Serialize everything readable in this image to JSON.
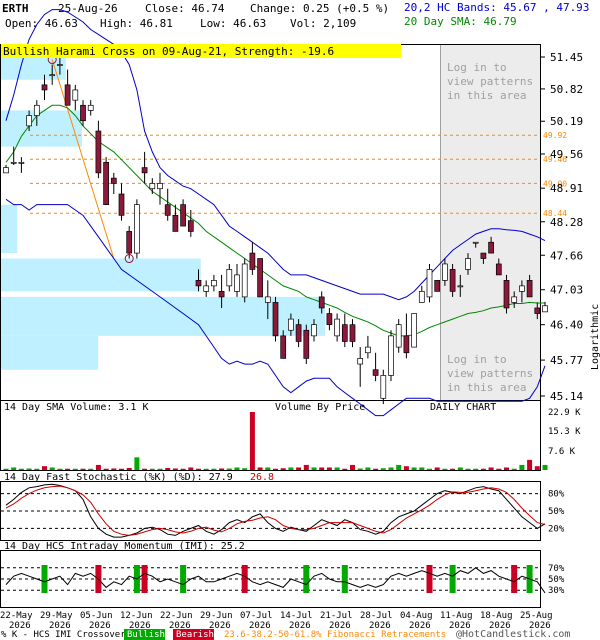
{
  "header": {
    "symbol": "ERTH",
    "date": "25-Aug-26",
    "close_label": "Close: 46.74",
    "change_label": "Change: 0.25 (+0.5 %)",
    "open_label": "Open: 46.63",
    "high_label": "High: 46.81",
    "low_label": "Low: 46.63",
    "vol_label": "Vol: 2,109",
    "bands_label": "20,2 HC Bands: 45.67 , 47.93",
    "sma_label": "20 Day SMA: 46.79"
  },
  "pattern_banner": "Bullish Harami Cross on 09-Aug-21, Strength: -19.6",
  "login_note": [
    "Log in to",
    "view patterns",
    "in this area"
  ],
  "panel_labels": {
    "volume": "14 Day SMA Volume: 3.1 K",
    "volume_by_price": "Volume By Price",
    "daily_chart": "DAILY CHART",
    "stochastic": "14 Day Fast Stochastic (%K) (%D): 27.9",
    "stochastic_d": "26.8",
    "momentum": "14 Day HCS Intraday Momentum (IMI): 25.2",
    "log_axis": "Logarithmic"
  },
  "footer": {
    "legend_prefix": "% K - HCS IMI Crossover:",
    "bullish": "Bullish",
    "bearish": "Bearish",
    "fib": "23.6-38.2-50-61.8% Fibonacci Retracements",
    "copyright": "@HotCandlestick.com"
  },
  "colors": {
    "bullish": "#00aa00",
    "bearish": "#cc0022",
    "candle_up": "#ffffff",
    "candle_down": "#8b1a3a",
    "band": "#0000cc",
    "sma": "#008800",
    "fib": "#ff8800",
    "vbp": "#bff0ff",
    "banner": "#ffff00"
  },
  "chart_data": {
    "type": "candlestick",
    "y_ticks": [
      "51.45",
      "50.82",
      "50.19",
      "49.56",
      "48.91",
      "48.28",
      "47.66",
      "47.03",
      "46.40",
      "45.77",
      "45.14"
    ],
    "fib_levels": [
      "49.92",
      "49.46",
      "49.00",
      "48.44"
    ],
    "x_labels": [
      [
        "22-May",
        "2026"
      ],
      [
        "29-May",
        "2026"
      ],
      [
        "05-Jun",
        "2026"
      ],
      [
        "12-Jun",
        "2026"
      ],
      [
        "22-Jun",
        "2026"
      ],
      [
        "29-Jun",
        "2026"
      ],
      [
        "07-Jul",
        "2026"
      ],
      [
        "14-Jul",
        "2026"
      ],
      [
        "21-Jul",
        "2026"
      ],
      [
        "28-Jul",
        "2026"
      ],
      [
        "04-Aug",
        "2026"
      ],
      [
        "11-Aug",
        "2026"
      ],
      [
        "18-Aug",
        "2026"
      ],
      [
        "25-Aug",
        "2026"
      ]
    ],
    "candles": [
      [
        49.2,
        49.35,
        49.2,
        49.3
      ],
      [
        49.4,
        49.7,
        49.35,
        49.4
      ],
      [
        49.4,
        49.5,
        49.2,
        49.4
      ],
      [
        50.1,
        50.4,
        50.0,
        50.3
      ],
      [
        50.3,
        50.6,
        50.1,
        50.5
      ],
      [
        50.9,
        51.1,
        50.6,
        50.8
      ],
      [
        51.1,
        51.3,
        50.9,
        51.1
      ],
      [
        51.3,
        51.45,
        51.1,
        51.3
      ],
      [
        50.9,
        51.2,
        50.5,
        50.5
      ],
      [
        50.6,
        50.9,
        50.4,
        50.8
      ],
      [
        50.5,
        50.6,
        50.1,
        50.2
      ],
      [
        50.4,
        50.6,
        50.3,
        50.5
      ],
      [
        50.0,
        50.2,
        49.1,
        49.2
      ],
      [
        49.4,
        49.5,
        48.6,
        48.6
      ],
      [
        49.1,
        49.2,
        48.8,
        49.0
      ],
      [
        48.8,
        49.0,
        48.3,
        48.4
      ],
      [
        48.1,
        48.2,
        47.6,
        47.7
      ],
      [
        47.7,
        48.7,
        47.6,
        48.6
      ],
      [
        49.3,
        49.6,
        49.0,
        49.2
      ],
      [
        48.9,
        49.1,
        48.8,
        49.0
      ],
      [
        48.9,
        49.2,
        48.6,
        49.0
      ],
      [
        48.6,
        48.9,
        48.3,
        48.4
      ],
      [
        48.4,
        48.6,
        48.1,
        48.1
      ],
      [
        48.6,
        48.7,
        48.2,
        48.2
      ],
      [
        48.3,
        48.5,
        48.0,
        48.1
      ],
      [
        47.2,
        47.4,
        47.0,
        47.1
      ],
      [
        47.0,
        47.2,
        46.9,
        47.1
      ],
      [
        47.1,
        47.3,
        47.0,
        47.2
      ],
      [
        47.0,
        47.3,
        46.7,
        46.9
      ],
      [
        47.1,
        47.5,
        47.0,
        47.4
      ],
      [
        47.0,
        47.5,
        46.9,
        47.3
      ],
      [
        46.9,
        47.6,
        46.8,
        47.5
      ],
      [
        47.7,
        47.9,
        47.3,
        47.4
      ],
      [
        47.6,
        47.6,
        46.9,
        46.9
      ],
      [
        46.8,
        47.2,
        46.5,
        46.9
      ],
      [
        46.8,
        46.9,
        46.1,
        46.2
      ],
      [
        46.2,
        46.3,
        45.8,
        45.8
      ],
      [
        46.3,
        46.6,
        46.2,
        46.5
      ],
      [
        46.4,
        46.5,
        46.0,
        46.1
      ],
      [
        46.3,
        46.4,
        45.7,
        45.8
      ],
      [
        46.2,
        46.5,
        46.1,
        46.4
      ],
      [
        46.9,
        47.0,
        46.6,
        46.7
      ],
      [
        46.6,
        46.7,
        46.3,
        46.4
      ],
      [
        46.2,
        46.6,
        46.1,
        46.5
      ],
      [
        46.4,
        46.6,
        46.0,
        46.1
      ],
      [
        46.4,
        46.5,
        46.0,
        46.1
      ],
      [
        45.7,
        46.0,
        45.3,
        45.8
      ],
      [
        45.9,
        46.2,
        45.8,
        46.0
      ],
      [
        45.6,
        45.9,
        45.4,
        45.5
      ],
      [
        45.1,
        45.6,
        45.0,
        45.5
      ],
      [
        45.5,
        46.3,
        45.4,
        46.2
      ],
      [
        46.0,
        46.5,
        45.9,
        46.4
      ],
      [
        46.2,
        46.6,
        45.8,
        45.9
      ],
      [
        46.0,
        46.6,
        46.0,
        46.6
      ],
      [
        46.8,
        47.1,
        46.8,
        47.0
      ],
      [
        46.9,
        47.5,
        46.8,
        47.4
      ],
      [
        47.2,
        47.2,
        47.0,
        47.0
      ],
      [
        47.2,
        47.6,
        47.1,
        47.5
      ],
      [
        47.4,
        47.5,
        46.9,
        47.0
      ],
      [
        47.1,
        47.3,
        46.9,
        47.1
      ],
      [
        47.4,
        47.7,
        47.3,
        47.6
      ],
      [
        47.9,
        47.9,
        47.8,
        47.9
      ],
      [
        47.7,
        47.7,
        47.5,
        47.6
      ],
      [
        47.9,
        48.0,
        47.7,
        47.7
      ],
      [
        47.5,
        47.6,
        47.3,
        47.3
      ],
      [
        47.2,
        47.3,
        46.6,
        46.7
      ],
      [
        46.8,
        47.0,
        46.7,
        46.9
      ],
      [
        47.0,
        47.2,
        46.8,
        47.1
      ],
      [
        47.2,
        47.3,
        46.9,
        46.9
      ],
      [
        46.7,
        46.8,
        46.5,
        46.6
      ],
      [
        46.63,
        46.81,
        46.63,
        46.74
      ]
    ],
    "sma": [
      49.4,
      49.6,
      49.9,
      50.1,
      50.3,
      50.4,
      50.5,
      50.5,
      50.45,
      50.3,
      50.1,
      49.95,
      49.8,
      49.7,
      49.6,
      49.45,
      49.3,
      49.15,
      49.0,
      48.85,
      48.75,
      48.65,
      48.55,
      48.45,
      48.35,
      48.25,
      48.1,
      48.0,
      47.9,
      47.8,
      47.7,
      47.6,
      47.5,
      47.4,
      47.3,
      47.2,
      47.1,
      47.05,
      47.0,
      46.9,
      46.85,
      46.8,
      46.75,
      46.7,
      46.62,
      46.55,
      46.5,
      46.45,
      46.38,
      46.3,
      46.25,
      46.2,
      46.2,
      46.22,
      46.28,
      46.35,
      46.4,
      46.45,
      46.5,
      46.55,
      46.6,
      46.62,
      46.65,
      46.7,
      46.72,
      46.75,
      46.78,
      46.78,
      46.8,
      46.79,
      46.79
    ],
    "band_upper": [
      50.2,
      50.7,
      51.3,
      51.8,
      52.1,
      52.3,
      52.4,
      52.4,
      52.35,
      52.25,
      52.15,
      52.0,
      51.9,
      51.8,
      51.7,
      51.55,
      51.3,
      50.8,
      50.0,
      49.6,
      49.3,
      49.15,
      49.05,
      48.95,
      48.9,
      48.8,
      48.7,
      48.6,
      48.4,
      48.2,
      48.1,
      48.0,
      47.9,
      47.8,
      47.7,
      47.55,
      47.4,
      47.3,
      47.3,
      47.3,
      47.25,
      47.2,
      47.15,
      47.1,
      47.05,
      47.0,
      46.95,
      46.95,
      46.95,
      46.95,
      46.9,
      46.85,
      46.9,
      47.0,
      47.15,
      47.3,
      47.45,
      47.6,
      47.75,
      47.85,
      47.95,
      48.05,
      48.1,
      48.15,
      48.15,
      48.13,
      48.12,
      48.1,
      48.05,
      48.0,
      47.93
    ],
    "band_lower": [
      48.7,
      48.6,
      48.6,
      48.5,
      48.6,
      48.6,
      48.6,
      48.6,
      48.6,
      48.5,
      48.4,
      48.2,
      48.0,
      47.8,
      47.6,
      47.4,
      47.3,
      47.2,
      47.1,
      47.0,
      46.9,
      46.8,
      46.7,
      46.6,
      46.5,
      46.4,
      46.2,
      46.0,
      45.8,
      45.7,
      45.75,
      45.7,
      45.7,
      45.75,
      45.7,
      45.5,
      45.3,
      45.2,
      45.3,
      45.4,
      45.45,
      45.45,
      45.45,
      45.3,
      45.2,
      45.1,
      45.0,
      44.9,
      44.8,
      44.8,
      44.9,
      45.0,
      45.1,
      45.1,
      45.1,
      45.1,
      45.05,
      45.05,
      45.05,
      45.05,
      45.05,
      45.05,
      45.05,
      45.05,
      45.05,
      45.05,
      45.05,
      45.05,
      45.1,
      45.3,
      45.67
    ],
    "volume_ticks": [
      "22.9 K",
      "15.3 K",
      "7.6 K"
    ],
    "volume": [
      0.5,
      1.0,
      0.5,
      0.6,
      0.5,
      1.5,
      1.0,
      0.5,
      0.5,
      0.5,
      0.5,
      0.5,
      2.0,
      0.5,
      0.6,
      0.5,
      0.8,
      5.0,
      0.5,
      0.5,
      0.5,
      0.8,
      0.6,
      0.5,
      1.0,
      0.5,
      0.5,
      0.5,
      0.6,
      0.6,
      1.0,
      0.7,
      22.9,
      1.0,
      1.0,
      0.5,
      0.7,
      1.0,
      1.0,
      2.0,
      1.0,
      1.0,
      1.0,
      1.0,
      0.5,
      2.0,
      0.6,
      1.0,
      0.5,
      0.7,
      1.0,
      2.0,
      1.5,
      1.0,
      1.0,
      0.5,
      1.0,
      0.5,
      0.5,
      1.0,
      0.5,
      0.5,
      0.5,
      1.0,
      0.5,
      1.0,
      0.5,
      2.0,
      4.0,
      1.5,
      2.0
    ],
    "vbp_rows": [
      {
        "lo": 51.45,
        "hi": 51.0,
        "len": 0.12
      },
      {
        "lo": 50.4,
        "hi": 49.7,
        "len": 0.15
      },
      {
        "lo": 48.6,
        "hi": 47.7,
        "len": 0.03
      },
      {
        "lo": 47.6,
        "hi": 47.0,
        "len": 0.37
      },
      {
        "lo": 46.9,
        "hi": 46.2,
        "len": 0.6
      },
      {
        "lo": 46.2,
        "hi": 45.6,
        "len": 0.18
      }
    ],
    "stoch_ticks": [
      "80%",
      "50%",
      "20%"
    ],
    "stoch_k": [
      60,
      70,
      82,
      90,
      92,
      95,
      96,
      94,
      90,
      85,
      70,
      40,
      20,
      10,
      5,
      5,
      8,
      12,
      20,
      22,
      18,
      10,
      8,
      15,
      20,
      25,
      15,
      10,
      18,
      30,
      35,
      30,
      40,
      45,
      30,
      20,
      15,
      22,
      18,
      15,
      25,
      35,
      30,
      25,
      35,
      30,
      18,
      15,
      10,
      15,
      30,
      40,
      45,
      50,
      60,
      70,
      80,
      85,
      82,
      80,
      85,
      90,
      92,
      88,
      85,
      70,
      55,
      40,
      30,
      20,
      28
    ],
    "stoch_d": [
      55,
      62,
      72,
      80,
      86,
      90,
      92,
      93,
      90,
      85,
      78,
      65,
      45,
      28,
      15,
      10,
      8,
      10,
      14,
      18,
      20,
      18,
      14,
      12,
      15,
      20,
      22,
      17,
      14,
      20,
      28,
      32,
      34,
      38,
      40,
      35,
      25,
      20,
      18,
      18,
      20,
      25,
      30,
      30,
      30,
      30,
      25,
      20,
      15,
      12,
      18,
      28,
      38,
      45,
      52,
      60,
      70,
      78,
      83,
      82,
      82,
      85,
      88,
      90,
      88,
      82,
      70,
      55,
      42,
      30,
      26.8
    ],
    "imi_ticks": [
      "70%",
      "50%",
      "30%"
    ],
    "imi": [
      40,
      55,
      60,
      55,
      50,
      45,
      50,
      55,
      40,
      60,
      55,
      60,
      50,
      35,
      45,
      40,
      55,
      50,
      60,
      55,
      45,
      50,
      45,
      40,
      50,
      55,
      45,
      45,
      50,
      55,
      60,
      55,
      45,
      40,
      45,
      40,
      35,
      50,
      45,
      40,
      55,
      60,
      50,
      45,
      45,
      40,
      35,
      40,
      35,
      40,
      55,
      60,
      55,
      60,
      65,
      60,
      55,
      60,
      55,
      65,
      60,
      70,
      60,
      65,
      55,
      50,
      45,
      55,
      50,
      45,
      25.2
    ],
    "crossovers": [
      {
        "i": 5,
        "c": "bullish"
      },
      {
        "i": 12,
        "c": "bearish"
      },
      {
        "i": 17,
        "c": "bullish"
      },
      {
        "i": 18,
        "c": "bearish"
      },
      {
        "i": 23,
        "c": "bullish"
      },
      {
        "i": 31,
        "c": "bearish"
      },
      {
        "i": 39,
        "c": "bullish"
      },
      {
        "i": 44,
        "c": "bullish"
      },
      {
        "i": 55,
        "c": "bearish"
      },
      {
        "i": 58,
        "c": "bullish"
      },
      {
        "i": 66,
        "c": "bearish"
      },
      {
        "i": 68,
        "c": "bullish"
      }
    ]
  }
}
